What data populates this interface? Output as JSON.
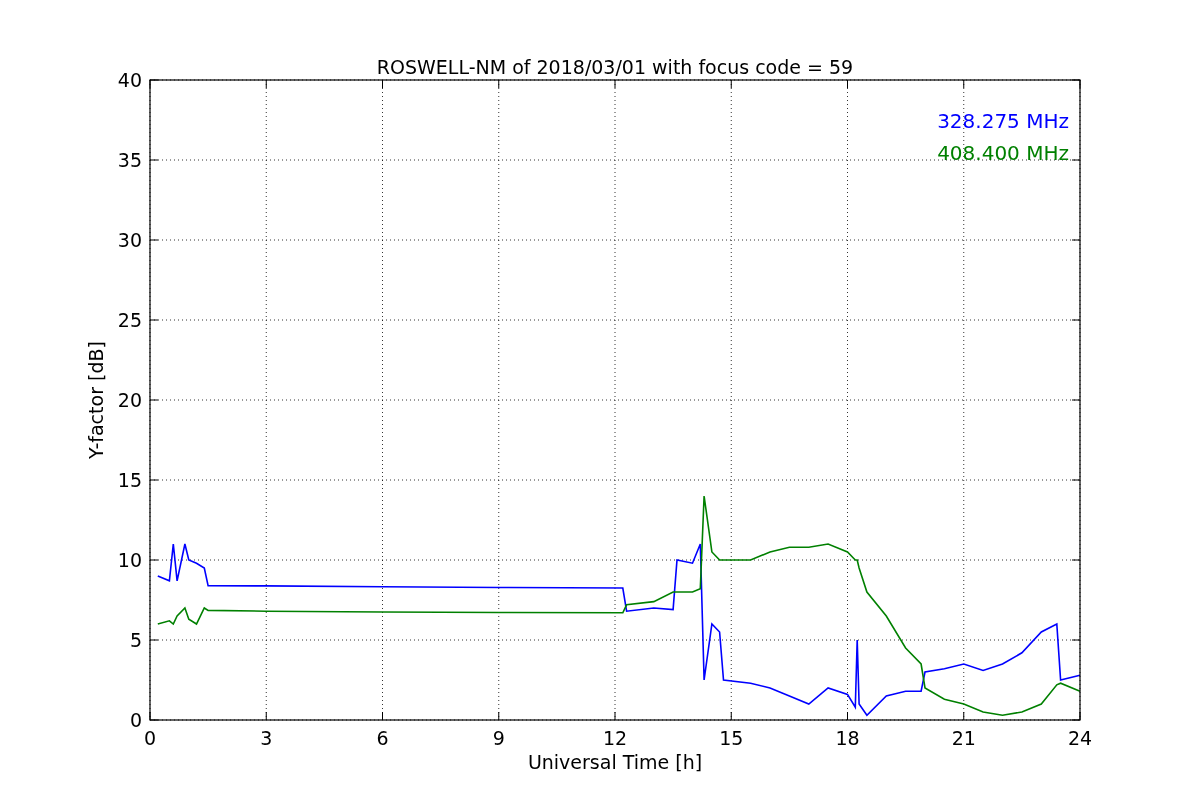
{
  "chart": {
    "chart_data": {
      "type": "line",
      "title": "ROSWELL-NM of 2018/03/01 with focus code = 59",
      "xlabel": "Universal Time [h]",
      "ylabel": "Y-factor [dB]",
      "x": [
        0.2,
        0.5,
        0.6,
        0.7,
        0.9,
        1.0,
        1.2,
        1.4,
        1.5,
        3,
        6,
        9,
        12.2,
        12.3,
        13,
        13.5,
        13.6,
        14,
        14.2,
        14.3,
        14.5,
        14.7,
        14.8,
        15.5,
        16,
        16.5,
        17,
        17.5,
        18,
        18.2,
        18.25,
        18.3,
        18.5,
        19,
        19.5,
        19.9,
        20,
        20.5,
        21,
        21.5,
        22,
        22.5,
        23,
        23.4,
        23.5,
        24
      ],
      "series": [
        {
          "name": "328.275 MHz",
          "color": "#0000ff",
          "values": [
            9.0,
            8.7,
            11.0,
            8.7,
            11.0,
            10.0,
            9.8,
            9.5,
            8.4,
            8.38,
            8.33,
            8.28,
            8.25,
            6.8,
            7.0,
            6.9,
            10.0,
            9.8,
            11.0,
            2.5,
            6.0,
            5.5,
            2.5,
            2.3,
            2.0,
            1.5,
            1.0,
            2.0,
            1.6,
            0.8,
            5.0,
            1.0,
            0.3,
            1.5,
            1.8,
            1.8,
            3.0,
            3.2,
            3.5,
            3.1,
            3.5,
            4.2,
            5.5,
            6.0,
            2.5,
            2.8
          ]
        },
        {
          "name": "408.400 MHz",
          "color": "#008000",
          "values": [
            6.0,
            6.2,
            6.0,
            6.5,
            7.0,
            6.3,
            6.0,
            7.0,
            6.85,
            6.8,
            6.75,
            6.72,
            6.7,
            7.2,
            7.4,
            8.0,
            8.0,
            8.0,
            8.2,
            14.0,
            10.5,
            10.0,
            10.0,
            10.0,
            10.5,
            10.8,
            10.8,
            11.0,
            10.5,
            10.0,
            10.0,
            9.5,
            8.0,
            6.5,
            4.5,
            3.5,
            2.0,
            1.3,
            1.0,
            0.5,
            0.3,
            0.5,
            1.0,
            2.2,
            2.3,
            1.8
          ]
        }
      ],
      "xlim": [
        0,
        24
      ],
      "ylim": [
        0,
        40
      ],
      "xticks": [
        0,
        3,
        6,
        9,
        12,
        15,
        18,
        21,
        24
      ],
      "yticks": [
        0,
        5,
        10,
        15,
        20,
        25,
        30,
        35,
        40
      ],
      "grid": true
    }
  }
}
